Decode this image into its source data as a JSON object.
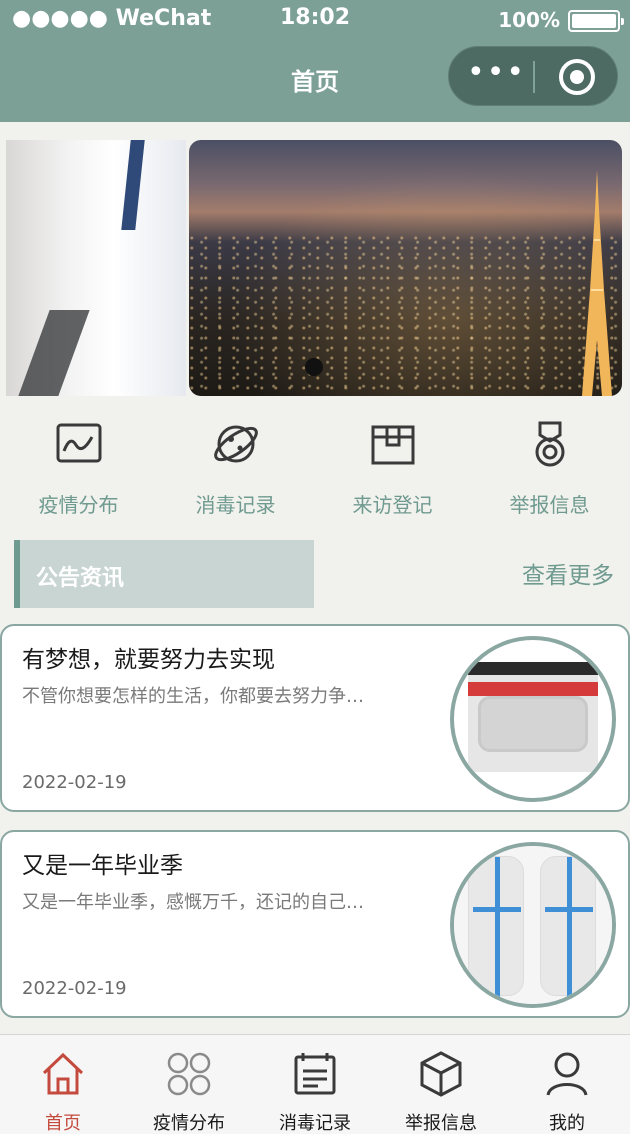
{
  "status_bar": {
    "carrier": "●●●●● WeChat",
    "time": "18:02",
    "battery": "100%"
  },
  "nav": {
    "title": "首页",
    "menu_icon": "more-dots-icon",
    "close_icon": "target-icon"
  },
  "banner": {
    "slides": [
      "doctor-image",
      "city-night-eiffel-tower-image"
    ],
    "active_index": 1
  },
  "quick_menu": [
    {
      "label": "疫情分布",
      "icon": "trend-chart-icon"
    },
    {
      "label": "消毒记录",
      "icon": "planet-icon"
    },
    {
      "label": "来访登记",
      "icon": "box-icon"
    },
    {
      "label": "举报信息",
      "icon": "medal-icon"
    }
  ],
  "section": {
    "title": "公告资讯",
    "more": "查看更多"
  },
  "news": [
    {
      "title": "有梦想，就要努力去实现",
      "desc": "不管你想要怎样的生活，你都要去努力争…",
      "date": "2022-02-19",
      "image": "goggles-image"
    },
    {
      "title": "又是一年毕业季",
      "desc": "又是一年毕业季，感慨万千，还记的自己…",
      "date": "2022-02-19",
      "image": "protective-suits-image"
    }
  ],
  "tabbar": [
    {
      "label": "首页",
      "icon": "home-icon",
      "active": true
    },
    {
      "label": "疫情分布",
      "icon": "grid-clover-icon",
      "active": false
    },
    {
      "label": "消毒记录",
      "icon": "clipboard-icon",
      "active": false
    },
    {
      "label": "举报信息",
      "icon": "cube-icon",
      "active": false
    },
    {
      "label": "我的",
      "icon": "user-icon",
      "active": false
    }
  ],
  "colors": {
    "primary": "#7c9f96",
    "accent_text": "#6f9a8f",
    "active_tab": "#c44a3d"
  }
}
